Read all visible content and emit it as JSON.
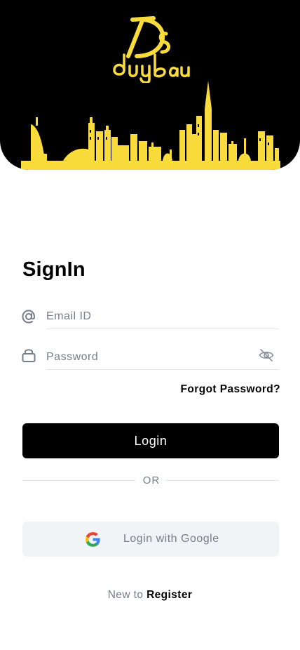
{
  "brand": {
    "logo_text": "Ds dubai",
    "accent_color": "#f9dc3c"
  },
  "signin": {
    "title": "SignIn",
    "email_placeholder": "Email ID",
    "password_placeholder": "Password",
    "forgot_password": "Forgot Password?",
    "login_button": "Login",
    "divider_text": "OR",
    "google_button": "Login with Google",
    "new_to_text": "New to ",
    "register_link": "Register"
  },
  "icons": {
    "email": "at-icon",
    "password": "lock-icon",
    "visibility": "eye-off-icon",
    "google": "google-icon"
  }
}
